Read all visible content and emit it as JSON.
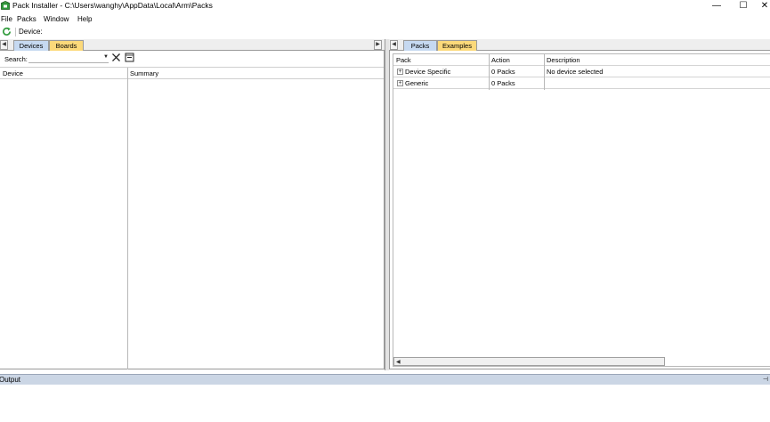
{
  "window": {
    "title": "Pack Installer - C:\\Users\\wanghy\\AppData\\Local\\Arm\\Packs",
    "minimize_glyph": "—",
    "maximize_glyph": "☐",
    "close_glyph": "✕"
  },
  "menu": [
    "File",
    "Packs",
    "Window",
    "Help"
  ],
  "toolbar": {
    "device_label": "Device:"
  },
  "left": {
    "tabs": [
      "Devices",
      "Boards"
    ],
    "search_label": "Search:",
    "search_value": "",
    "columns": [
      "Device",
      "Summary"
    ]
  },
  "right": {
    "tabs": [
      "Packs",
      "Examples"
    ],
    "columns": [
      "Pack",
      "Action",
      "Description"
    ],
    "rows": [
      {
        "pack": "Device Specific",
        "action": "0 Packs",
        "description": "No device selected"
      },
      {
        "pack": "Generic",
        "action": "0 Packs",
        "description": ""
      }
    ]
  },
  "output": {
    "label": "Output",
    "pin_glyph": "⊣"
  },
  "icons": {
    "app": "pack-installer-icon",
    "refresh": "refresh-icon",
    "clear": "close-icon",
    "collapse": "collapse-all-icon"
  },
  "colors": {
    "active_tab": "#c6d9f1",
    "inactive_tab": "#fcd97a",
    "output_bar": "#cbd6e5"
  }
}
